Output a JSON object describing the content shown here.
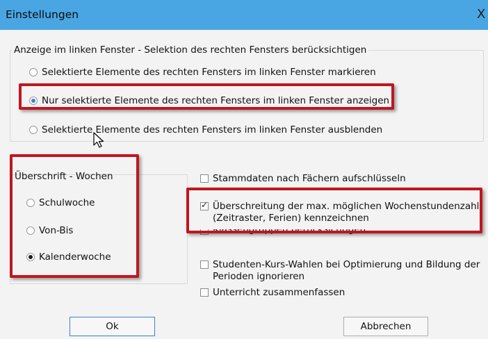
{
  "window": {
    "title": "Einstellungen",
    "close_glyph": "X"
  },
  "group_left_window": {
    "label": "Anzeige im linken Fenster - Selektion des rechten Fensters berücksichtigen",
    "options": [
      {
        "label": "Selektierte Elemente des rechten Fensters im linken Fenster markieren",
        "selected": false
      },
      {
        "label": "Nur selektierte Elemente des rechten Fensters im linken Fenster anzeigen",
        "selected": true
      },
      {
        "label": "Selektierte Elemente des rechten Fensters im linken Fenster ausblenden",
        "selected": false
      }
    ]
  },
  "group_weeks": {
    "label": "Überschrift - Wochen",
    "options": [
      {
        "label": "Schulwoche",
        "selected": false
      },
      {
        "label": "Von-Bis",
        "selected": false
      },
      {
        "label": "Kalenderwoche",
        "selected": true
      }
    ]
  },
  "checkboxes": [
    {
      "label": "Stammdaten nach Fächern aufschlüsseln",
      "checked": false
    },
    {
      "label": "Überschreitung der max. möglichen Wochenstundenzahl",
      "label2": "(Zeitraster, Ferien) kennzeichnen",
      "checked": true
    },
    {
      "label": "Klassengruppen berücksichtigen",
      "checked": false
    },
    {
      "label": "Studenten-Kurs-Wahlen bei Optimierung und Bildung der",
      "label2": "Perioden ignorieren",
      "checked": false
    },
    {
      "label": "Unterricht zusammenfassen",
      "checked": false
    }
  ],
  "buttons": {
    "ok": "Ok",
    "cancel": "Abbrechen"
  },
  "colors": {
    "titlebar": "#4aa6e3",
    "highlight": "#c0161f",
    "selected_radio": "#3a86d4"
  }
}
